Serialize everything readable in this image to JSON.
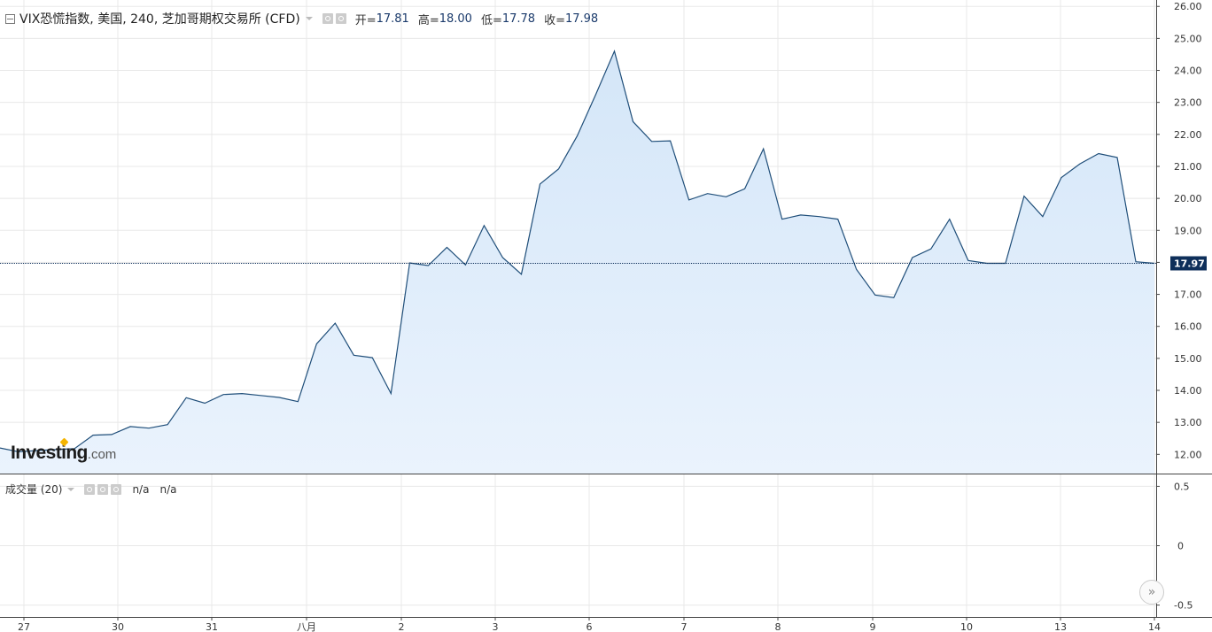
{
  "legend": {
    "title": "VIX恐慌指数, 美国, 240, 芝加哥期权交易所 (CFD)",
    "open_label": "开=",
    "open": "17.81",
    "high_label": "高=",
    "high": "18.00",
    "low_label": "低=",
    "low": "17.78",
    "close_label": "收=",
    "close": "17.98"
  },
  "volume_legend": {
    "label": "成交量 (20)",
    "value1": "n/a",
    "value2": "n/a"
  },
  "logo": {
    "main": "Investing",
    "suffix": ".com"
  },
  "nav": {
    "scroll_right": "»"
  },
  "colors": {
    "line": "#1f4e79",
    "area_top": "#d4e6f8",
    "area_bottom": "#eaf3fd",
    "last_price_bg": "#0e2f5a",
    "grid": "#e8e8e8",
    "axis": "#444444"
  },
  "chart_data": {
    "type": "area",
    "title": "VIX恐慌指数, 美国, 240, 芝加哥期权交易所 (CFD)",
    "ylim": [
      11.4,
      26.2
    ],
    "y_ticks": [
      "12.00",
      "13.00",
      "14.00",
      "15.00",
      "16.00",
      "17.00",
      "18.00",
      "19.00",
      "20.00",
      "21.00",
      "22.00",
      "23.00",
      "24.00",
      "25.00",
      "26.00"
    ],
    "last_price": "17.97",
    "x_tick_labels": [
      "27",
      "30",
      "31",
      "八月",
      "2",
      "3",
      "6",
      "7",
      "8",
      "9",
      "10",
      "13",
      "14"
    ],
    "grid": true,
    "series": [
      {
        "values": [
          12.2,
          12.08,
          12.12,
          12.15,
          12.18,
          12.6,
          12.62,
          12.87,
          12.82,
          12.93,
          13.77,
          13.6,
          13.87,
          13.9,
          13.84,
          13.78,
          13.65,
          15.45,
          16.1,
          15.1,
          15.02,
          13.9,
          17.98,
          17.9,
          18.47,
          17.92,
          19.15,
          18.15,
          17.63,
          20.45,
          20.92,
          21.95,
          23.25,
          24.6,
          22.4,
          21.78,
          21.8,
          19.95,
          20.15,
          20.05,
          20.3,
          21.55,
          19.35,
          19.48,
          19.43,
          19.35,
          17.78,
          16.98,
          16.9,
          18.15,
          18.42,
          19.35,
          18.06,
          17.97,
          17.97,
          20.07,
          19.43,
          20.65,
          21.08,
          21.4,
          21.28,
          18.02,
          17.97
        ]
      }
    ],
    "volume": {
      "ylim": [
        -0.6,
        0.6
      ],
      "y_ticks": [
        "0.5",
        "0",
        "-0.5"
      ]
    }
  }
}
